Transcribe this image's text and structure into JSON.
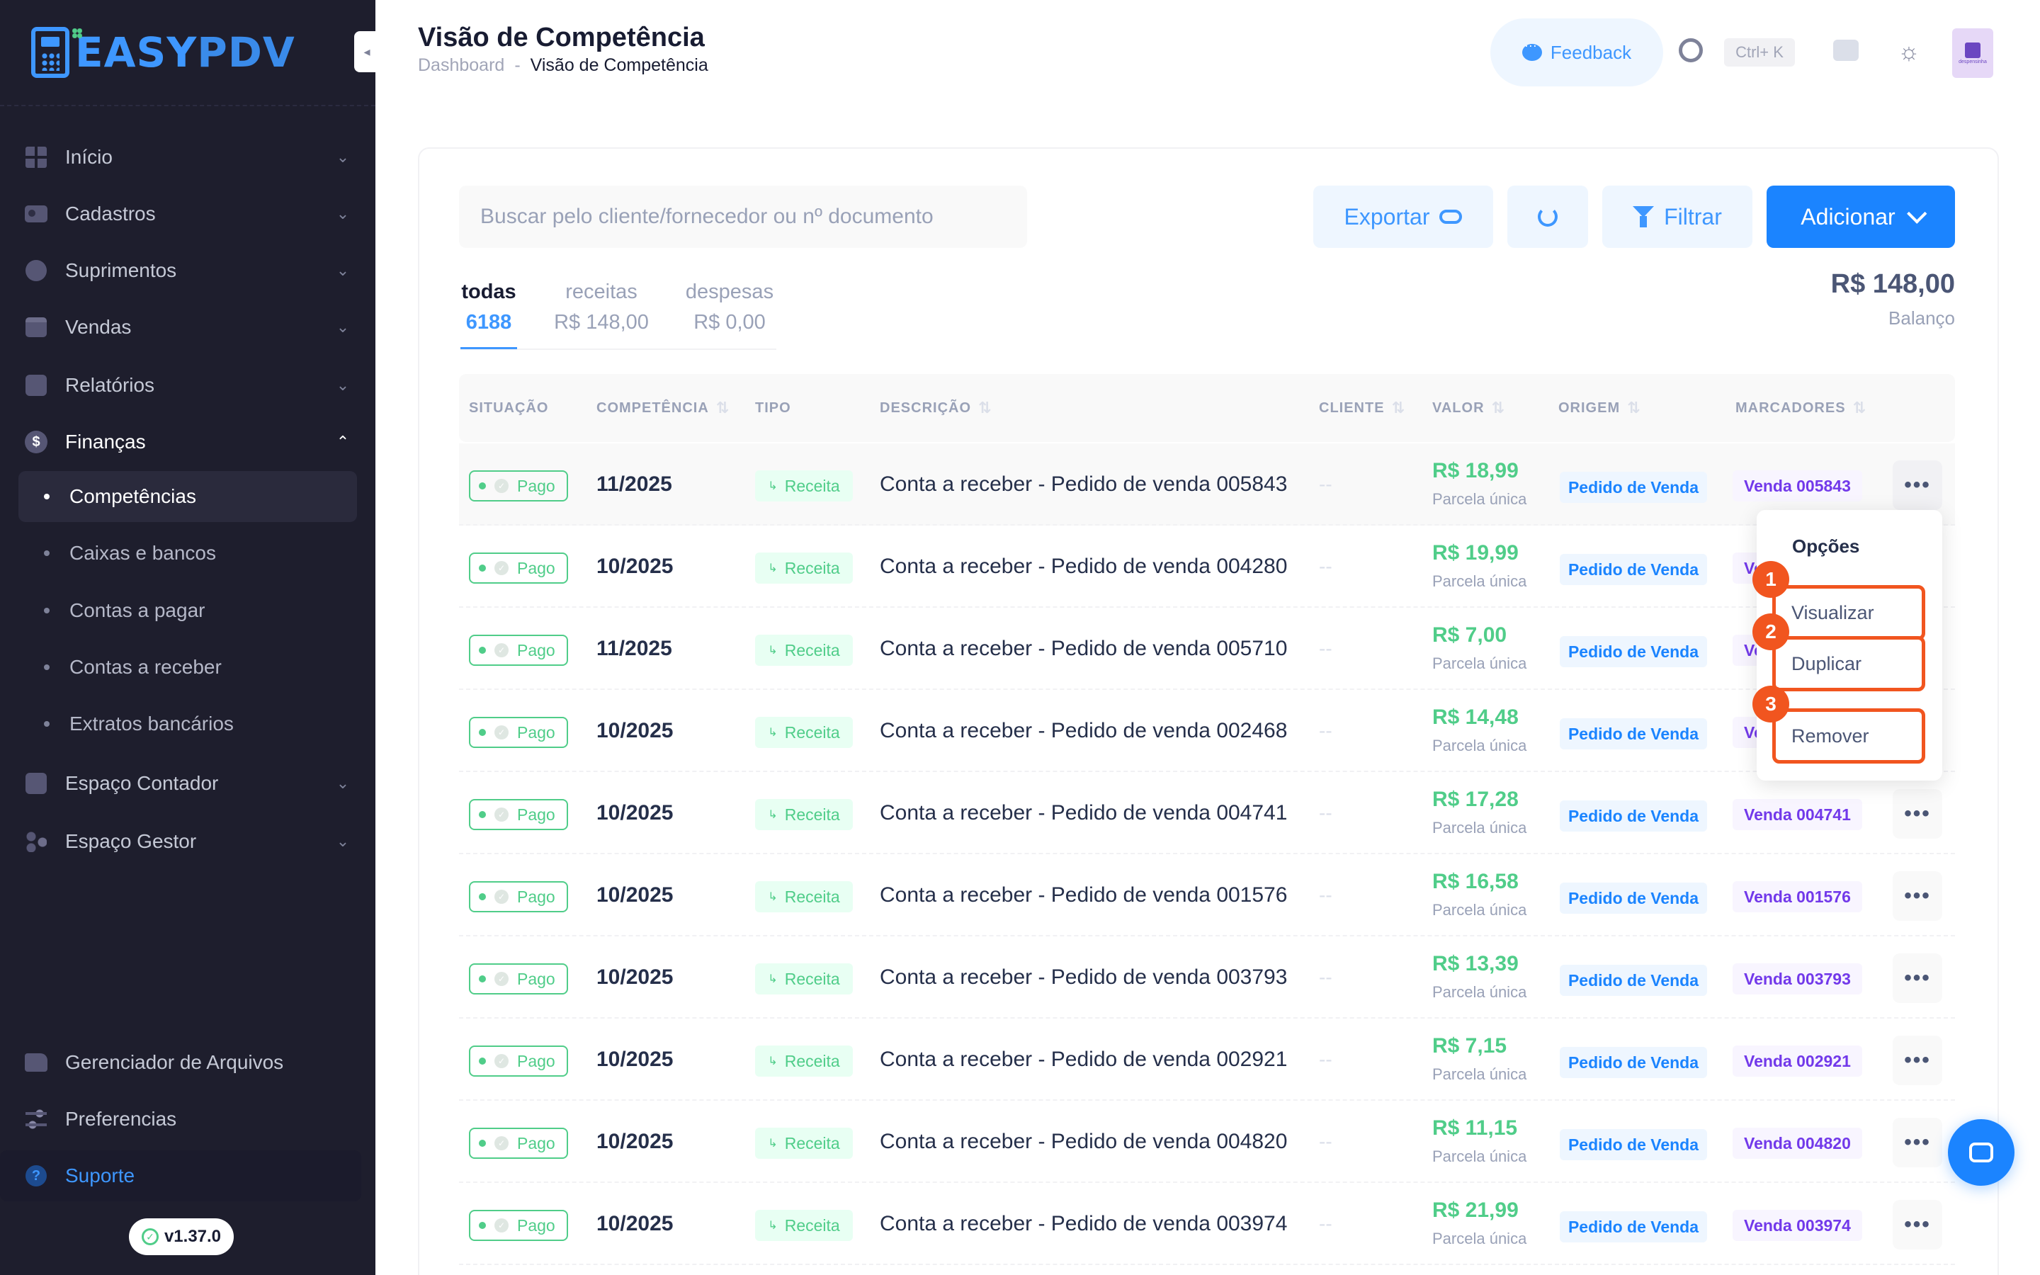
{
  "brand": {
    "logo_text_a": "EASY",
    "logo_text_b": "PDV"
  },
  "sidebar": {
    "items": [
      {
        "label": "Início",
        "icon": "grid-icon"
      },
      {
        "label": "Cadastros",
        "icon": "card-icon"
      },
      {
        "label": "Suprimentos",
        "icon": "ball-icon"
      },
      {
        "label": "Vendas",
        "icon": "calendar-icon"
      },
      {
        "label": "Relatórios",
        "icon": "chart-icon"
      },
      {
        "label": "Finanças",
        "icon": "dollar-icon"
      },
      {
        "label": "Espaço Contador",
        "icon": "box-icon"
      },
      {
        "label": "Espaço Gestor",
        "icon": "people-icon"
      },
      {
        "label": "Gerenciador de Arquivos",
        "icon": "folder-icon"
      },
      {
        "label": "Preferencias",
        "icon": "sliders-icon"
      },
      {
        "label": "Suporte",
        "icon": "help-icon"
      }
    ],
    "sub_items": [
      "Competências",
      "Caixas e bancos",
      "Contas a pagar",
      "Contas a receber",
      "Extratos bancários"
    ],
    "version": "v1.37.0"
  },
  "header": {
    "title": "Visão de Competência",
    "breadcrumb": [
      "Dashboard",
      "-",
      "Visão de Competência"
    ],
    "feedback": "Feedback",
    "shortcut": "Ctrl+ K",
    "avatar_text": "despensinha"
  },
  "toolbar": {
    "search_placeholder": "Buscar pelo cliente/fornecedor ou nº documento",
    "export": "Exportar",
    "filter": "Filtrar",
    "add": "Adicionar"
  },
  "tabs": [
    {
      "label": "todas",
      "value": "6188"
    },
    {
      "label": "receitas",
      "value": "R$ 148,00"
    },
    {
      "label": "despesas",
      "value": "R$ 0,00"
    }
  ],
  "balance": {
    "value": "R$ 148,00",
    "label": "Balanço"
  },
  "table": {
    "columns": [
      "SITUAÇÃO",
      "COMPETÊNCIA",
      "TIPO",
      "DESCRIÇÃO",
      "CLIENTE",
      "VALOR",
      "ORIGEM",
      "MARCADORES"
    ],
    "rows": [
      {
        "status": "Pago",
        "comp": "11/2025",
        "tipo": "Receita",
        "desc": "Conta a receber - Pedido de venda 005843",
        "cliente": "--",
        "valor": "R$ 18,99",
        "parcela": "Parcela única",
        "origem": "Pedido de Venda",
        "marcador": "Venda 005843"
      },
      {
        "status": "Pago",
        "comp": "10/2025",
        "tipo": "Receita",
        "desc": "Conta a receber - Pedido de venda 004280",
        "cliente": "--",
        "valor": "R$ 19,99",
        "parcela": "Parcela única",
        "origem": "Pedido de Venda",
        "marcador": "Ve"
      },
      {
        "status": "Pago",
        "comp": "11/2025",
        "tipo": "Receita",
        "desc": "Conta a receber - Pedido de venda 005710",
        "cliente": "--",
        "valor": "R$ 7,00",
        "parcela": "Parcela única",
        "origem": "Pedido de Venda",
        "marcador": "Ve"
      },
      {
        "status": "Pago",
        "comp": "10/2025",
        "tipo": "Receita",
        "desc": "Conta a receber - Pedido de venda 002468",
        "cliente": "--",
        "valor": "R$ 14,48",
        "parcela": "Parcela única",
        "origem": "Pedido de Venda",
        "marcador": "Ve"
      },
      {
        "status": "Pago",
        "comp": "10/2025",
        "tipo": "Receita",
        "desc": "Conta a receber - Pedido de venda 004741",
        "cliente": "--",
        "valor": "R$ 17,28",
        "parcela": "Parcela única",
        "origem": "Pedido de Venda",
        "marcador": "Venda 004741"
      },
      {
        "status": "Pago",
        "comp": "10/2025",
        "tipo": "Receita",
        "desc": "Conta a receber - Pedido de venda 001576",
        "cliente": "--",
        "valor": "R$ 16,58",
        "parcela": "Parcela única",
        "origem": "Pedido de Venda",
        "marcador": "Venda 001576"
      },
      {
        "status": "Pago",
        "comp": "10/2025",
        "tipo": "Receita",
        "desc": "Conta a receber - Pedido de venda 003793",
        "cliente": "--",
        "valor": "R$ 13,39",
        "parcela": "Parcela única",
        "origem": "Pedido de Venda",
        "marcador": "Venda 003793"
      },
      {
        "status": "Pago",
        "comp": "10/2025",
        "tipo": "Receita",
        "desc": "Conta a receber - Pedido de venda 002921",
        "cliente": "--",
        "valor": "R$ 7,15",
        "parcela": "Parcela única",
        "origem": "Pedido de Venda",
        "marcador": "Venda 002921"
      },
      {
        "status": "Pago",
        "comp": "10/2025",
        "tipo": "Receita",
        "desc": "Conta a receber - Pedido de venda 004820",
        "cliente": "--",
        "valor": "R$ 11,15",
        "parcela": "Parcela única",
        "origem": "Pedido de Venda",
        "marcador": "Venda 004820"
      },
      {
        "status": "Pago",
        "comp": "10/2025",
        "tipo": "Receita",
        "desc": "Conta a receber - Pedido de venda 003974",
        "cliente": "--",
        "valor": "R$ 21,99",
        "parcela": "Parcela única",
        "origem": "Pedido de Venda",
        "marcador": "Venda 003974"
      }
    ]
  },
  "menu": {
    "title": "Opções",
    "items": [
      {
        "step": "1",
        "label": "Visualizar"
      },
      {
        "step": "2",
        "label": "Duplicar"
      },
      {
        "step": "3",
        "label": "Remover"
      }
    ]
  },
  "colors": {
    "accent": "#1b84ff",
    "success": "#50cd89",
    "sidebar": "#1e1e2d",
    "highlight": "#f1551f",
    "marker": "#7239ea"
  }
}
